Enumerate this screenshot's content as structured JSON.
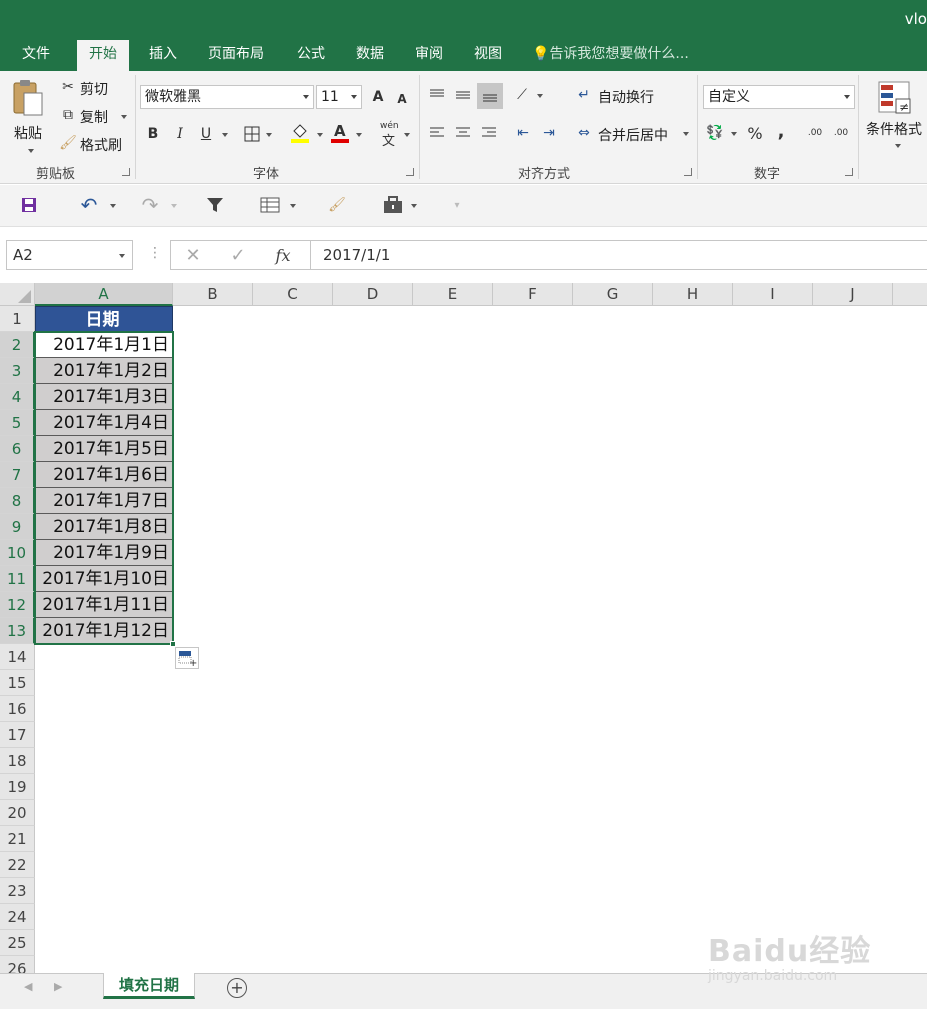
{
  "window": {
    "title": "vlo"
  },
  "tabs": [
    "文件",
    "开始",
    "插入",
    "页面布局",
    "公式",
    "数据",
    "审阅",
    "视图"
  ],
  "tell_me": "告诉我您想要做什么...",
  "clipboard": {
    "paste": "粘贴",
    "cut": "剪切",
    "copy": "复制",
    "format_painter": "格式刷",
    "group": "剪贴板"
  },
  "font": {
    "name": "微软雅黑",
    "size": "11",
    "grow": "A",
    "shrink": "A",
    "bold": "B",
    "italic": "I",
    "underline": "U",
    "phonetic": "wén",
    "phonetic_char": "文",
    "group": "字体"
  },
  "alignment": {
    "wrap": "自动换行",
    "merge": "合并后居中",
    "group": "对齐方式"
  },
  "number": {
    "format": "自定义",
    "percent": "%",
    "comma": ",",
    "inc_dec": ".00",
    "dec_dec": ".00",
    "group": "数字"
  },
  "styles": {
    "conditional": "条件格式"
  },
  "formula_bar": {
    "name_box": "A2",
    "fx": "fx",
    "formula": "2017/1/1"
  },
  "columns": [
    "A",
    "B",
    "C",
    "D",
    "E",
    "F",
    "G",
    "H",
    "I",
    "J"
  ],
  "rows": [
    "1",
    "2",
    "3",
    "4",
    "5",
    "6",
    "7",
    "8",
    "9",
    "10",
    "11",
    "12",
    "13",
    "14",
    "15",
    "16",
    "17",
    "18",
    "19",
    "20",
    "21",
    "22",
    "23",
    "24",
    "25",
    "26"
  ],
  "cells": {
    "A1": "日期",
    "A2": "2017年1月1日",
    "A3": "2017年1月2日",
    "A4": "2017年1月3日",
    "A5": "2017年1月4日",
    "A6": "2017年1月5日",
    "A7": "2017年1月6日",
    "A8": "2017年1月7日",
    "A9": "2017年1月8日",
    "A10": "2017年1月9日",
    "A11": "2017年1月10日",
    "A12": "2017年1月11日",
    "A13": "2017年1月12日"
  },
  "sheet": {
    "tab": "填充日期",
    "add": "+"
  },
  "watermark": {
    "logo": "Baidu经验",
    "url": "jingyan.baidu.com"
  },
  "colors": {
    "excel_green": "#217346",
    "header_fill": "#2f5496",
    "data_fill": "#d0cece"
  }
}
